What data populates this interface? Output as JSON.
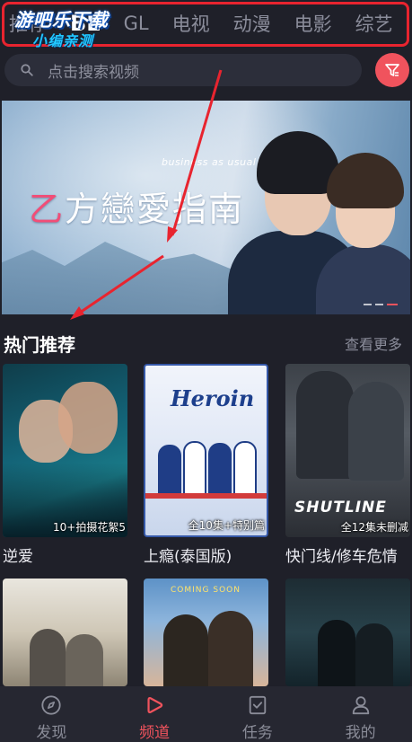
{
  "tabs": {
    "items": [
      {
        "label": "推荐"
      },
      {
        "label": "BL"
      },
      {
        "label": "GL"
      },
      {
        "label": "电视"
      },
      {
        "label": "动漫"
      },
      {
        "label": "电影"
      },
      {
        "label": "综艺"
      }
    ],
    "active_index": 1
  },
  "watermark": {
    "line1": "游吧乐下载",
    "line2": "小编亲测"
  },
  "search": {
    "placeholder": "点击搜索视频",
    "icon": "search-icon"
  },
  "filter": {
    "icon": "filter-icon",
    "color": "#f0535d"
  },
  "banner": {
    "title_first": "乙",
    "title_rest": "方戀愛指南",
    "subtitle": "business as usual",
    "slide_count": 3,
    "active_slide": 3
  },
  "section": {
    "title": "热门推荐",
    "more": "查看更多"
  },
  "cards": [
    {
      "title": "逆爱",
      "badge": "10+拍摄花絮5"
    },
    {
      "title": "上瘾(泰国版)",
      "badge": "全10集+特别篇",
      "poster_text": "Heroin"
    },
    {
      "title": "快门线/修车危情",
      "badge": "全12集未删减",
      "poster_text": "SHUTLINE"
    },
    {
      "title": "",
      "badge": ""
    },
    {
      "title": "",
      "badge": "",
      "poster_text": "COMING SOON"
    },
    {
      "title": "",
      "badge": ""
    }
  ],
  "nav": {
    "items": [
      {
        "label": "发现",
        "icon": "compass-icon"
      },
      {
        "label": "频道",
        "icon": "play-icon"
      },
      {
        "label": "任务",
        "icon": "task-icon"
      },
      {
        "label": "我的",
        "icon": "user-icon"
      }
    ],
    "active_index": 1
  },
  "colors": {
    "background": "#1f2029",
    "accent": "#f0535d",
    "annotation": "#e8242f"
  }
}
